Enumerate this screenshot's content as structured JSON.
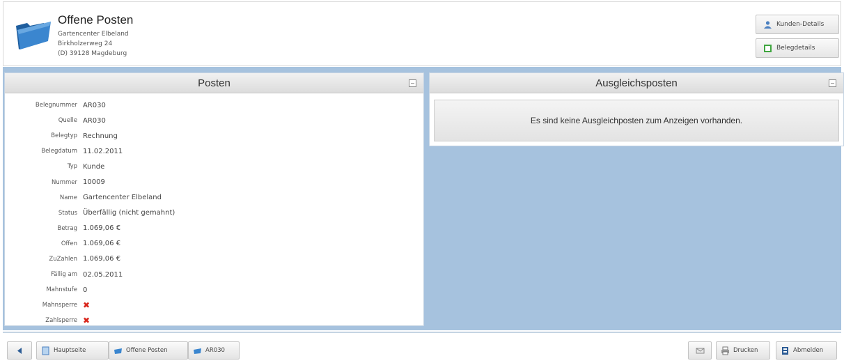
{
  "header": {
    "title": "Offene Posten",
    "address": [
      "Gartencenter Elbeland",
      "Birkholzerweg 24",
      "(D) 39128 Magdeburg"
    ],
    "buttons": {
      "customer_details": "Kunden-Details",
      "document_details": "Belegdetails"
    }
  },
  "posten": {
    "title": "Posten",
    "fields": [
      {
        "label": "Belegnummer",
        "value": "AR030"
      },
      {
        "label": "Quelle",
        "value": "AR030"
      },
      {
        "label": "Belegtyp",
        "value": "Rechnung"
      },
      {
        "label": "Belegdatum",
        "value": "11.02.2011"
      },
      {
        "label": "Typ",
        "value": "Kunde"
      },
      {
        "label": "Nummer",
        "value": "10009"
      },
      {
        "label": "Name",
        "value": "Gartencenter Elbeland"
      },
      {
        "label": "Status",
        "value": "Überfällig (nicht gemahnt)"
      },
      {
        "label": "Betrag",
        "value": "1.069,06 €"
      },
      {
        "label": "Offen",
        "value": "1.069,06 €"
      },
      {
        "label": "ZuZahlen",
        "value": "1.069,06 €"
      },
      {
        "label": "Fällig am",
        "value": "02.05.2011"
      },
      {
        "label": "Mahnstufe",
        "value": "0"
      },
      {
        "label": "Mahnsperre",
        "value": "✖"
      },
      {
        "label": "Zahlsperre",
        "value": "✖"
      }
    ]
  },
  "ausgleich": {
    "title": "Ausgleichsposten",
    "empty_message": "Es sind keine Ausgleichposten zum Anzeigen vorhanden."
  },
  "footer": {
    "breadcrumb": [
      "Hauptseite",
      "Offene Posten",
      "AR030"
    ],
    "print": "Drucken",
    "logout": "Abmelden"
  },
  "colors": {
    "band": "#a6c2de",
    "x_mark": "#d9261c"
  }
}
